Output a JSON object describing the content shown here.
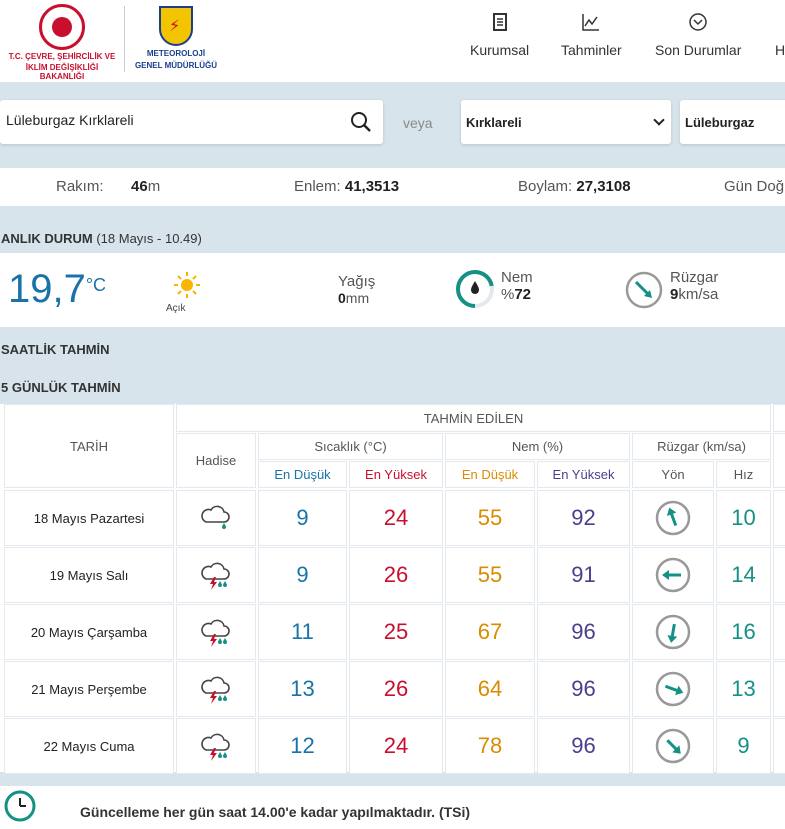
{
  "header": {
    "ministry_line1": "T.C. ÇEVRE, ŞEHİRCİLİK VE",
    "ministry_line2": "İKLİM DEĞİŞİKLİĞİ BAKANLIĞI",
    "mgm_line1": "METEOROLOJİ",
    "mgm_line2": "GENEL MÜDÜRLÜĞÜ",
    "nav": [
      "Kurumsal",
      "Tahminler",
      "Son Durumlar",
      "H"
    ]
  },
  "search": {
    "value": "Lüleburgaz Kırklareli",
    "or_label": "veya",
    "province": "Kırklareli",
    "district": "Lüleburgaz"
  },
  "info": {
    "altitude_label": "Rakım:",
    "altitude_value": "46",
    "altitude_unit": "m",
    "lat_label": "Enlem:",
    "lat_value": "41,3513",
    "lon_label": "Boylam:",
    "lon_value": "27,3108",
    "sunrise_label": "Gün Doğ"
  },
  "current": {
    "title": "ANLIK DURUM",
    "time": "(18 Mayıs - 10.49)",
    "temp": "19,7",
    "temp_unit": "°C",
    "condition": "Açık",
    "precip_label": "Yağış",
    "precip_value": "0",
    "precip_unit": "mm",
    "humidity_label": "Nem",
    "humidity_prefix": "%",
    "humidity_value": "72",
    "humidity_level": 0.72,
    "wind_label": "Rüzgar",
    "wind_value": "9",
    "wind_unit": "km/sa"
  },
  "hourly_title": "SAATLİK TAHMİN",
  "daily_title": "5 GÜNLÜK TAHMİN",
  "table": {
    "predicted_header": "TAHMİN EDİLEN",
    "date_header": "TARİH",
    "event_header": "Hadise",
    "temp_header": "Sıcaklık (°C)",
    "hum_header": "Nem (%)",
    "wind_header": "Rüzgar (km/sa)",
    "min_label": "En Düşük",
    "max_label": "En Yüksek",
    "dir_label": "Yön",
    "speed_label": "Hız",
    "rows": [
      {
        "date": "18 Mayıs Pazartesi",
        "icon": "light-rain-cloud-icon",
        "tmin": "9",
        "tmax": "24",
        "hmin": "55",
        "hmax": "92",
        "wind_deg": 340,
        "speed": "10"
      },
      {
        "date": "19 Mayıs Salı",
        "icon": "thunderstorm-rain-icon",
        "tmin": "9",
        "tmax": "26",
        "hmin": "55",
        "hmax": "91",
        "wind_deg": 270,
        "speed": "14"
      },
      {
        "date": "20 Mayıs Çarşamba",
        "icon": "thunderstorm-rain-icon",
        "tmin": "11",
        "tmax": "25",
        "hmin": "67",
        "hmax": "96",
        "wind_deg": 190,
        "speed": "16"
      },
      {
        "date": "21 Mayıs Perşembe",
        "icon": "thunderstorm-rain-icon",
        "tmin": "13",
        "tmax": "26",
        "hmin": "64",
        "hmax": "96",
        "wind_deg": 110,
        "speed": "13"
      },
      {
        "date": "22 Mayıs Cuma",
        "icon": "thunderstorm-rain-icon",
        "tmin": "12",
        "tmax": "24",
        "hmin": "78",
        "hmax": "96",
        "wind_deg": 135,
        "speed": "9"
      }
    ]
  },
  "footer": {
    "note": "Güncelleme her gün saat 14.00'e kadar yapılmaktadır. (TSi)"
  },
  "colors": {
    "blue": "#1a73a8",
    "red": "#c8102e",
    "orange": "#d98c00",
    "purple": "#4a3f8c",
    "green": "#149184"
  }
}
